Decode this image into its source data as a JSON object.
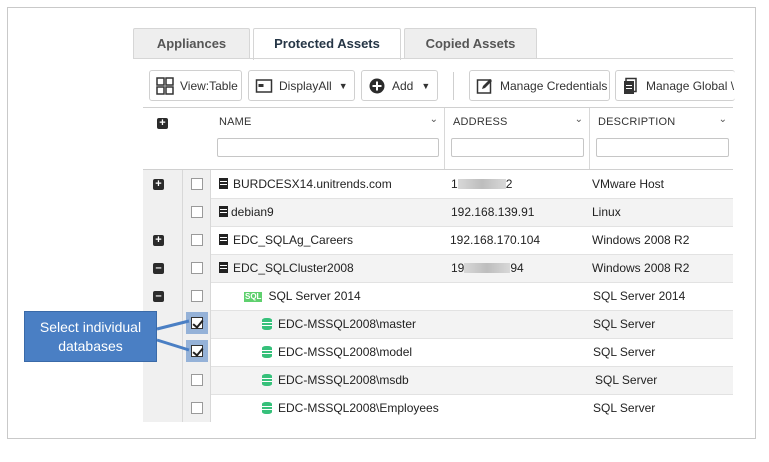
{
  "tabs": [
    {
      "label": "Appliances",
      "active": false
    },
    {
      "label": "Protected Assets",
      "active": true
    },
    {
      "label": "Copied Assets",
      "active": false
    }
  ],
  "toolbar": {
    "view_label": "View:Table",
    "display_label": "DisplayAll",
    "add_label": "Add",
    "manage_credentials_label": "Manage Credentials",
    "manage_global_label": "Manage Global \\"
  },
  "columns": [
    {
      "label": "NAME",
      "filter_value": ""
    },
    {
      "label": "ADDRESS",
      "filter_value": ""
    },
    {
      "label": "DESCRIPTION",
      "filter_value": ""
    }
  ],
  "rows": [
    {
      "name": "BURDCESX14.unitrends.com",
      "address_prefix": "1",
      "address_suffix": "2",
      "address_blurred": true,
      "description": "VMware Host",
      "expander": "plus",
      "checked": false,
      "icon": "server-icon",
      "indent": 0
    },
    {
      "name": "debian9",
      "address": "192.168.139.91",
      "description": "Linux",
      "expander": "",
      "checked": false,
      "icon": "server-icon",
      "indent": 0
    },
    {
      "name": "EDC_SQLAg_Careers",
      "address": "192.168.170.104",
      "description": "Windows 2008 R2",
      "expander": "plus",
      "checked": false,
      "icon": "server-icon",
      "indent": 0
    },
    {
      "name": "EDC_SQLCluster2008",
      "address_prefix": "19",
      "address_suffix": "94",
      "address_blurred": true,
      "description": "Windows 2008 R2",
      "expander": "minus",
      "checked": false,
      "icon": "server-icon",
      "indent": 0
    },
    {
      "name": "SQL Server 2014",
      "address": "",
      "description": "SQL Server 2014",
      "expander": "minus",
      "checked": false,
      "icon": "sql-instance-icon",
      "indent": 1
    },
    {
      "name": "EDC-MSSQL2008\\master",
      "address": "",
      "description": "SQL Server",
      "expander": "",
      "checked": true,
      "icon": "database-icon",
      "indent": 2
    },
    {
      "name": "EDC-MSSQL2008\\model",
      "address": "",
      "description": "SQL Server",
      "expander": "",
      "checked": true,
      "icon": "database-icon",
      "indent": 2
    },
    {
      "name": "EDC-MSSQL2008\\msdb",
      "address": "",
      "description": "SQL Server",
      "expander": "",
      "checked": false,
      "icon": "database-icon",
      "indent": 2
    },
    {
      "name": "EDC-MSSQL2008\\Employees",
      "address": "",
      "description": "SQL Server",
      "expander": "",
      "checked": false,
      "icon": "database-icon",
      "indent": 2
    }
  ],
  "sql_badge": "SQL",
  "callout": {
    "line1": "Select individual",
    "line2": "databases"
  },
  "colors": {
    "accent": "#4a7fc4",
    "db_green": "#36c07a"
  }
}
